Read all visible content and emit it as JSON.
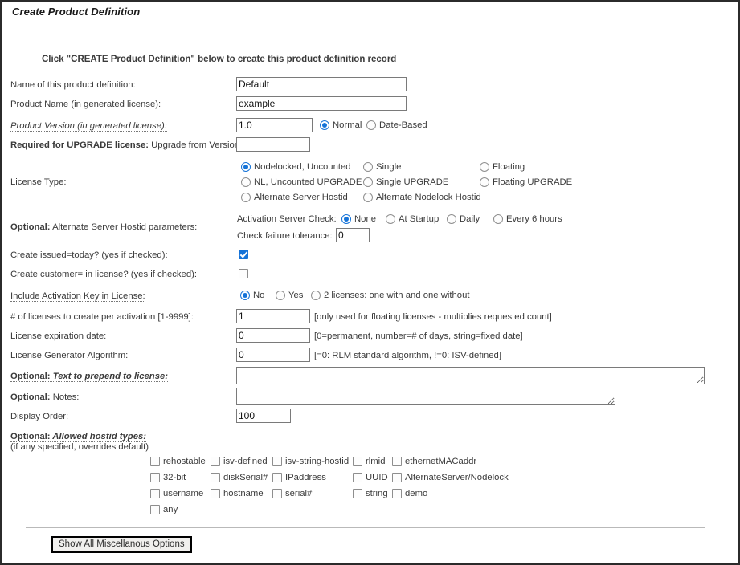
{
  "page": {
    "title": "Create Product Definition",
    "instruction": "Click \"CREATE Product Definition\" below to create this product definition record"
  },
  "colors": {
    "accent": "#1573d8",
    "text": "#3a3a3a",
    "border": "#2b2b2b",
    "field_border": "#7a7a7a"
  },
  "fields": {
    "name": {
      "label": "Name of this product definition:",
      "value": "Default"
    },
    "product_name": {
      "label": "Product Name (in generated license):",
      "value": "example"
    },
    "product_version": {
      "label": "Product Version (in generated license):",
      "value": "1.0",
      "options": [
        {
          "label": "Normal",
          "selected": true
        },
        {
          "label": "Date-Based",
          "selected": false
        }
      ]
    },
    "upgrade_from": {
      "label_bold": "Required for UPGRADE license:",
      "label_rest": " Upgrade from Version:",
      "value": ""
    },
    "license_type": {
      "label": "License Type:",
      "options": [
        {
          "label": "Nodelocked, Uncounted",
          "selected": true,
          "col": 1,
          "row": 1
        },
        {
          "label": "Single",
          "selected": false,
          "col": 2,
          "row": 1
        },
        {
          "label": "Floating",
          "selected": false,
          "col": 3,
          "row": 1
        },
        {
          "label": "NL, Uncounted UPGRADE",
          "selected": false,
          "col": 1,
          "row": 2
        },
        {
          "label": "Single UPGRADE",
          "selected": false,
          "col": 2,
          "row": 2
        },
        {
          "label": "Floating UPGRADE",
          "selected": false,
          "col": 3,
          "row": 2
        },
        {
          "label": "Alternate Server Hostid",
          "selected": false,
          "col": 1,
          "row": 3
        },
        {
          "label": "Alternate Nodelock Hostid",
          "selected": false,
          "col": 2,
          "row": 3
        }
      ]
    },
    "alt_server_hostid": {
      "label_bold": "Optional:",
      "label_rest": " Alternate Server Hostid parameters:",
      "activation_check_label": "Activation Server Check:",
      "activation_options": [
        {
          "label": "None",
          "selected": true
        },
        {
          "label": "At Startup",
          "selected": false
        },
        {
          "label": "Daily",
          "selected": false
        },
        {
          "label": "Every 6 hours",
          "selected": false
        }
      ],
      "tolerance_label": "Check failure tolerance:",
      "tolerance_value": "0"
    },
    "issued_today": {
      "label": "Create issued=today? (yes if checked):",
      "checked": true
    },
    "create_customer": {
      "label": "Create customer= in license? (yes if checked):",
      "checked": false
    },
    "activation_key": {
      "label": "Include Activation Key in License:",
      "options": [
        {
          "label": "No",
          "selected": true
        },
        {
          "label": "Yes",
          "selected": false
        },
        {
          "label": "2 licenses: one with and one without",
          "selected": false
        }
      ]
    },
    "licenses_per_activation": {
      "label": "# of licenses to create per activation [1-9999]:",
      "value": "1",
      "hint": "[only used for floating licenses - multiplies requested count]"
    },
    "expiration_date": {
      "label": "License expiration date:",
      "value": "0",
      "hint": "[0=permanent, number=# of days, string=fixed date]"
    },
    "generator_algorithm": {
      "label": "License Generator Algorithm:",
      "value": "0",
      "hint": "[=0: RLM standard algorithm, !=0: ISV-defined]"
    },
    "prepend_text": {
      "label_bold": "Optional:",
      "label_rest": " Text to prepend to license:",
      "value": ""
    },
    "notes": {
      "label_bold": "Optional:",
      "label_rest": " Notes:",
      "value": ""
    },
    "display_order": {
      "label": "Display Order:",
      "value": "100"
    },
    "allowed_hostid_types": {
      "label_bold": "Optional:",
      "label_rest": " Allowed hostid types:",
      "sublabel": "(if any specified, overrides default)",
      "options": [
        {
          "label": "rehostable",
          "checked": false,
          "col": 1,
          "row": 1
        },
        {
          "label": "isv-defined",
          "checked": false,
          "col": 2,
          "row": 1
        },
        {
          "label": "isv-string-hostid",
          "checked": false,
          "col": 3,
          "row": 1
        },
        {
          "label": "rlmid",
          "checked": false,
          "col": 4,
          "row": 1
        },
        {
          "label": "ethernetMACaddr",
          "checked": false,
          "col": 5,
          "row": 1
        },
        {
          "label": "32-bit",
          "checked": false,
          "col": 1,
          "row": 2
        },
        {
          "label": "diskSerial#",
          "checked": false,
          "col": 2,
          "row": 2
        },
        {
          "label": "IPaddress",
          "checked": false,
          "col": 3,
          "row": 2
        },
        {
          "label": "UUID",
          "checked": false,
          "col": 4,
          "row": 2
        },
        {
          "label": "AlternateServer/Nodelock",
          "checked": false,
          "col": 5,
          "row": 2
        },
        {
          "label": "username",
          "checked": false,
          "col": 1,
          "row": 3
        },
        {
          "label": "hostname",
          "checked": false,
          "col": 2,
          "row": 3
        },
        {
          "label": "serial#",
          "checked": false,
          "col": 3,
          "row": 3
        },
        {
          "label": "string",
          "checked": false,
          "col": 4,
          "row": 3
        },
        {
          "label": "demo",
          "checked": false,
          "col": 5,
          "row": 3
        },
        {
          "label": "any",
          "checked": false,
          "col": 1,
          "row": 4
        }
      ]
    }
  },
  "footer": {
    "misc_button": "Show All Miscellanous Options"
  }
}
